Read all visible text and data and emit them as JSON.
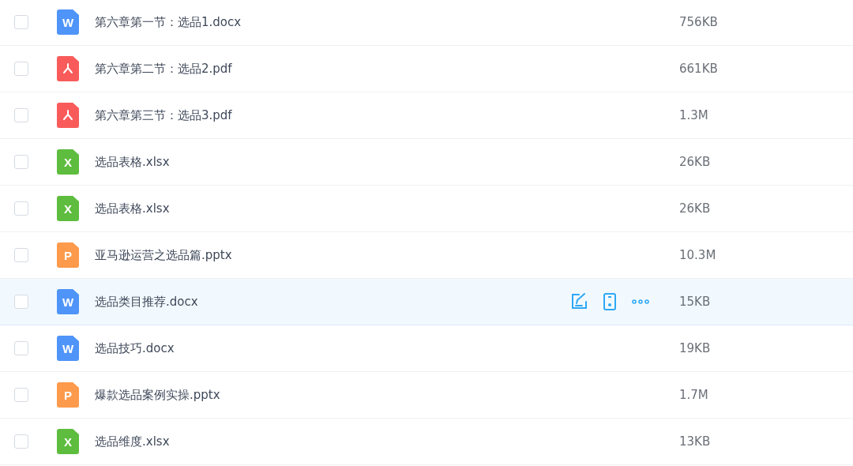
{
  "files": [
    {
      "kind": "word",
      "badge": "W",
      "name": "第六章第一节：选品1.docx",
      "size": "756KB",
      "checked": false,
      "highlighted": false
    },
    {
      "kind": "pdf",
      "name": "第六章第二节：选品2.pdf",
      "size": "661KB",
      "checked": false,
      "highlighted": false
    },
    {
      "kind": "pdf",
      "name": "第六章第三节：选品3.pdf",
      "size": "1.3M",
      "checked": false,
      "highlighted": false
    },
    {
      "kind": "excel",
      "badge": "X",
      "name": "选品表格.xlsx",
      "size": "26KB",
      "checked": false,
      "highlighted": false
    },
    {
      "kind": "excel",
      "badge": "X",
      "name": "选品表格.xlsx",
      "size": "26KB",
      "checked": false,
      "highlighted": false
    },
    {
      "kind": "ppt",
      "badge": "P",
      "name": "亚马逊运营之选品篇.pptx",
      "size": "10.3M",
      "checked": false,
      "highlighted": false
    },
    {
      "kind": "word",
      "badge": "W",
      "name": "选品类目推荐.docx",
      "size": "15KB",
      "checked": false,
      "highlighted": true
    },
    {
      "kind": "word",
      "badge": "W",
      "name": "选品技巧.docx",
      "size": "19KB",
      "checked": false,
      "highlighted": false
    },
    {
      "kind": "ppt",
      "badge": "P",
      "name": "爆款选品案例实操.pptx",
      "size": "1.7M",
      "checked": false,
      "highlighted": false
    },
    {
      "kind": "excel",
      "badge": "X",
      "name": "选品维度.xlsx",
      "size": "13KB",
      "checked": false,
      "highlighted": false
    }
  ]
}
